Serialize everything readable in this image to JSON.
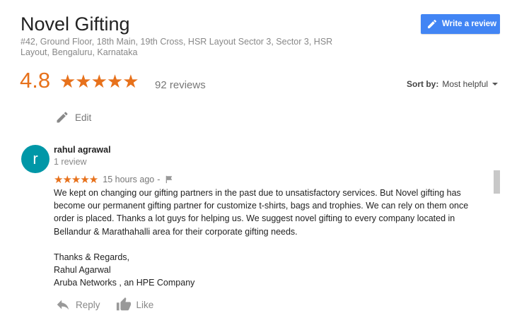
{
  "place": {
    "name": "Novel Gifting",
    "address": "#42, Ground Floor, 18th Main, 19th Cross, HSR Layout Sector 3, Sector 3, HSR Layout, Bengaluru, Karnataka"
  },
  "write_review": {
    "label": "Write a review",
    "icon": "pencil-icon"
  },
  "rating": {
    "value": "4.8",
    "stars": "★★★★★",
    "reviews_count": "92 reviews"
  },
  "sort": {
    "label": "Sort by:",
    "value": "Most helpful"
  },
  "edit": {
    "label": "Edit"
  },
  "review": {
    "avatar_letter": "r",
    "author": "rahul agrawal",
    "author_reviews": "1 review",
    "stars": "★★★★★",
    "time": "15 hours ago",
    "separator": "-",
    "paragraphs": [
      "We kept on changing our gifting partners in the past due to unsatisfactory services. But Novel gifting has become our permanent gifting partner for customize t-shirts, bags and trophies. We can rely on them once order is placed. Thanks a lot guys for helping us. We suggest novel gifting to every company located in Bellandur & Marathahalli area for their corporate gifting needs.",
      "Thanks & Regards,\nRahul Agarwal\nAruba Networks , an HPE Company"
    ]
  },
  "actions": {
    "reply": "Reply",
    "like": "Like"
  },
  "colors": {
    "accent_orange": "#e7711b",
    "button_blue": "#4285f4",
    "avatar_teal": "#0097a7"
  }
}
